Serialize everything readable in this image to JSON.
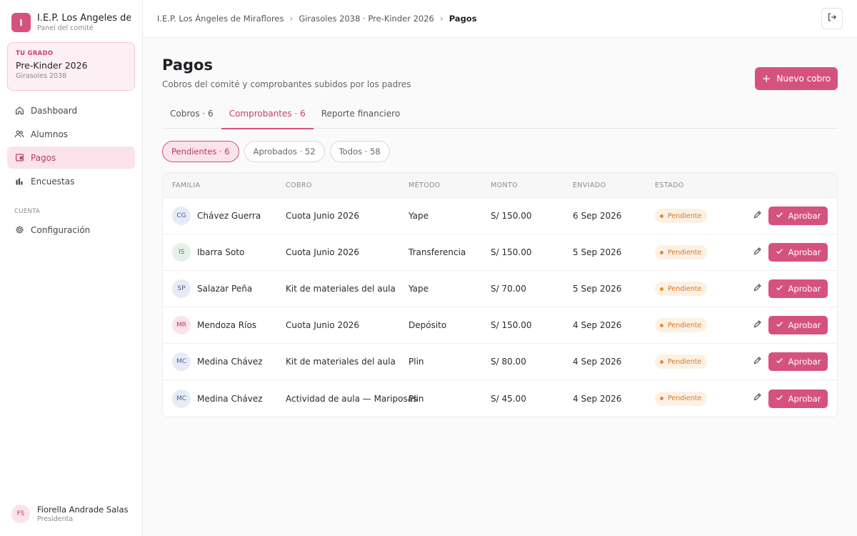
{
  "sidebar": {
    "brand": {
      "logo_letter": "I",
      "name": "I.E.P. Los Ángeles de …",
      "subtitle": "Panel del comité"
    },
    "grade_card": {
      "kicker": "TU GRADO",
      "name": "Pre-Kinder 2026",
      "sub": "Girasoles 2038"
    },
    "nav": [
      {
        "label": "Dashboard",
        "icon": "home-icon",
        "active": false
      },
      {
        "label": "Alumnos",
        "icon": "users-icon",
        "active": false
      },
      {
        "label": "Pagos",
        "icon": "wallet-icon",
        "active": true
      },
      {
        "label": "Encuestas",
        "icon": "bar-chart-icon",
        "active": false
      }
    ],
    "section_label": "CUENTA",
    "settings": {
      "label": "Configuración",
      "icon": "gear-icon"
    },
    "user": {
      "initials": "FS",
      "name": "Fiorella Andrade Salas",
      "role": "Presidenta"
    }
  },
  "breadcrumb": [
    "I.E.P. Los Ángeles de Miraflores",
    "Girasoles 2038 · Pre-Kinder 2026",
    "Pagos"
  ],
  "header": {
    "title": "Pagos",
    "subtitle": "Cobros del comité y comprobantes subidos por los padres",
    "new_button": "Nuevo cobro"
  },
  "tabs": [
    {
      "label": "Cobros · 6",
      "active": false
    },
    {
      "label": "Comprobantes · 6",
      "active": true
    },
    {
      "label": "Reporte financiero",
      "active": false
    }
  ],
  "filters": [
    {
      "label": "Pendientes · 6",
      "active": true
    },
    {
      "label": "Aprobados · 52",
      "active": false
    },
    {
      "label": "Todos · 58",
      "active": false
    }
  ],
  "table": {
    "headers": [
      "FAMILIA",
      "COBRO",
      "MÉTODO",
      "MONTO",
      "ENVIADO",
      "ESTADO"
    ],
    "approve_label": "Aprobar",
    "rows": [
      {
        "initials": "CG",
        "avatar_bg": "#e6ecf5",
        "avatar_fg": "#4a6390",
        "family": "Chávez Guerra",
        "charge": "Cuota Junio 2026",
        "method": "Yape",
        "amount": "S/ 150.00",
        "sent": "6 Sep 2026",
        "status": "Pendiente"
      },
      {
        "initials": "IS",
        "avatar_bg": "#e5f1e8",
        "avatar_fg": "#4b7d5a",
        "family": "Ibarra Soto",
        "charge": "Cuota Junio 2026",
        "method": "Transferencia",
        "amount": "S/ 150.00",
        "sent": "5 Sep 2026",
        "status": "Pendiente"
      },
      {
        "initials": "SP",
        "avatar_bg": "#e6ecf5",
        "avatar_fg": "#4a6390",
        "family": "Salazar Peña",
        "charge": "Kit de materiales del aula",
        "method": "Yape",
        "amount": "S/ 70.00",
        "sent": "5 Sep 2026",
        "status": "Pendiente"
      },
      {
        "initials": "MR",
        "avatar_bg": "#fbe3ec",
        "avatar_fg": "#b73a66",
        "family": "Mendoza Ríos",
        "charge": "Cuota Junio 2026",
        "method": "Depósito",
        "amount": "S/ 150.00",
        "sent": "4 Sep 2026",
        "status": "Pendiente"
      },
      {
        "initials": "MC",
        "avatar_bg": "#e6ecf5",
        "avatar_fg": "#4a6390",
        "family": "Medina Chávez",
        "charge": "Kit de materiales del aula",
        "method": "Plin",
        "amount": "S/ 80.00",
        "sent": "4 Sep 2026",
        "status": "Pendiente"
      },
      {
        "initials": "MC",
        "avatar_bg": "#e6ecf5",
        "avatar_fg": "#4a6390",
        "family": "Medina Chávez",
        "charge": "Actividad de aula — Mariposas",
        "method": "Plin",
        "amount": "S/ 45.00",
        "sent": "4 Sep 2026",
        "status": "Pendiente"
      }
    ]
  },
  "colors": {
    "accent": "#d6527e",
    "accent_soft": "#fbe3ec",
    "pending": "#d47a26"
  }
}
